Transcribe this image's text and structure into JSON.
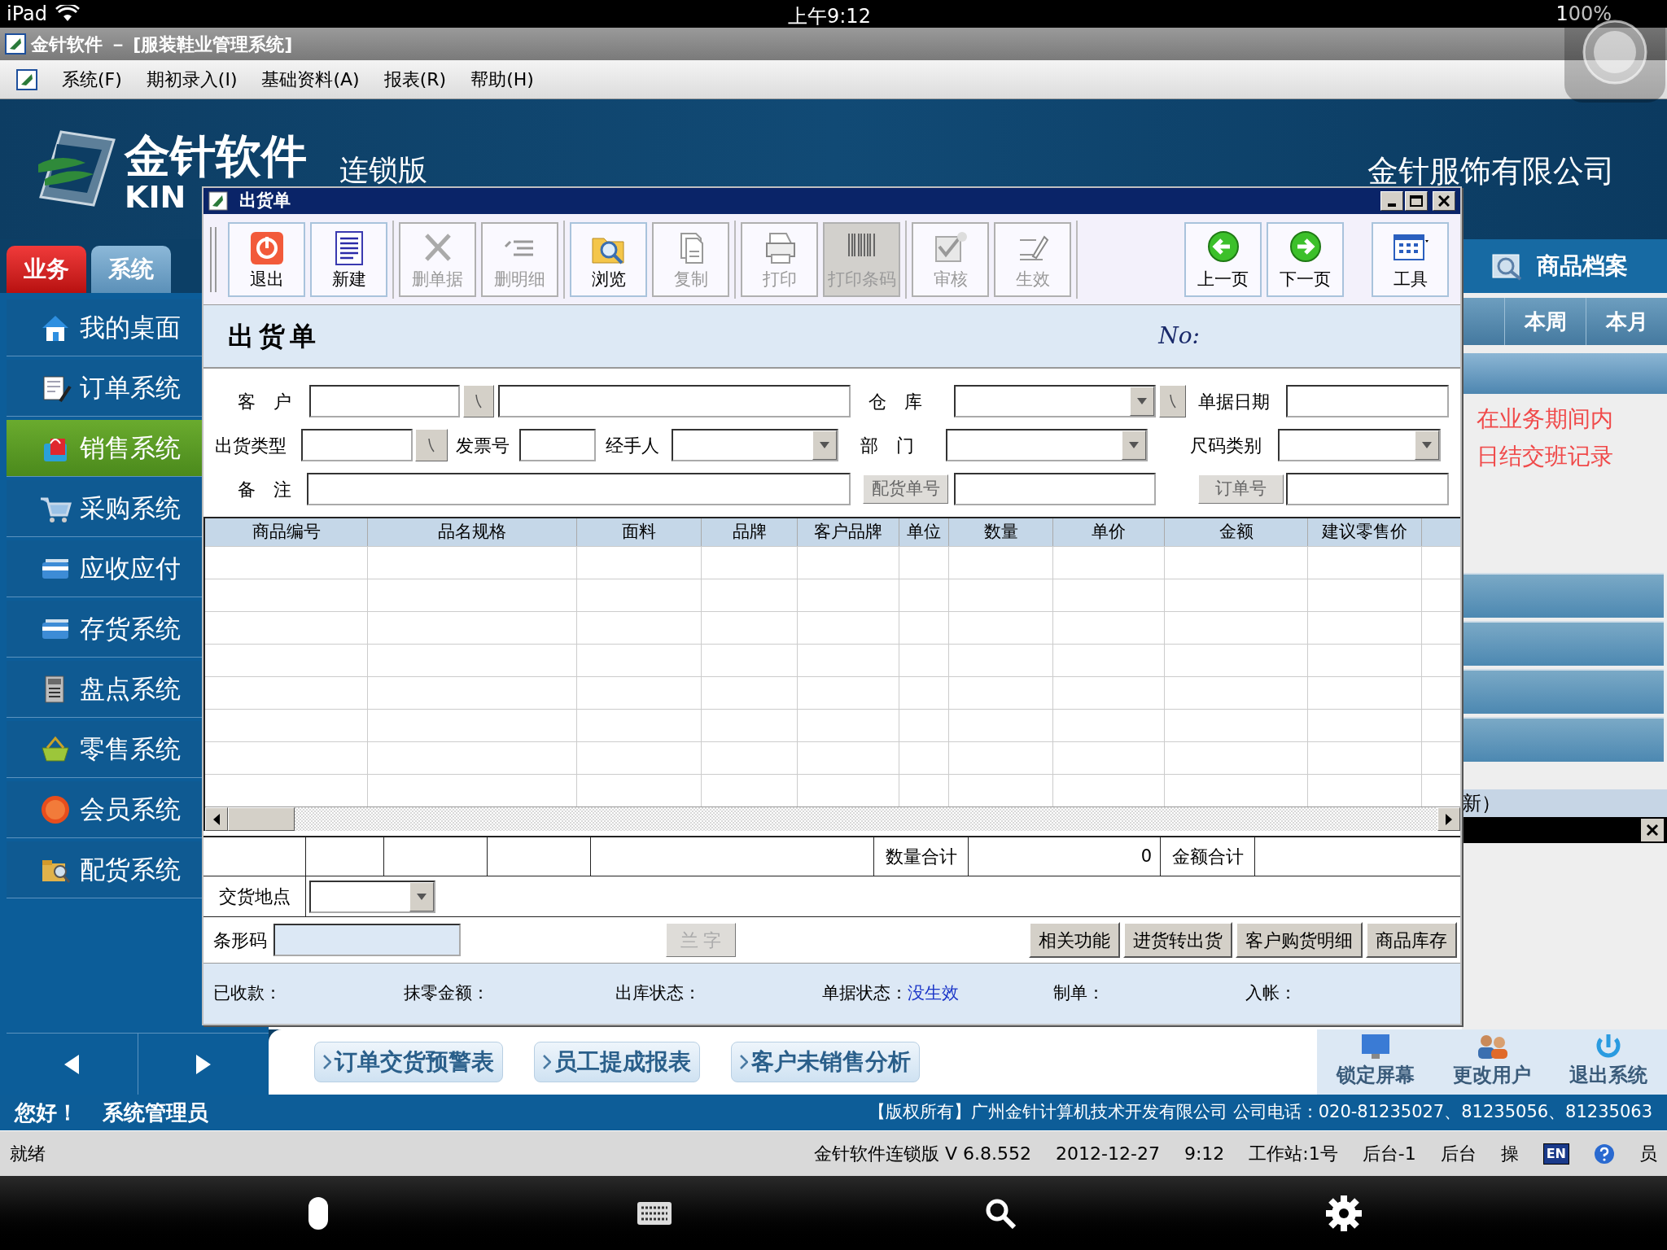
{
  "ios_status": {
    "device": "iPad",
    "time": "上午9:12",
    "battery": "100%"
  },
  "app_title": "金针软件 － [服装鞋业管理系统]",
  "menu": [
    "系统(F)",
    "期初录入(I)",
    "基础资料(A)",
    "报表(R)",
    "帮助(H)"
  ],
  "banner": {
    "brand": "金针软件",
    "brand_latin": "KIN",
    "edition": "连锁版",
    "company": "金针服饰有限公司"
  },
  "main_tabs": [
    {
      "label": "业务",
      "selected": true
    },
    {
      "label": "系统",
      "selected": false
    }
  ],
  "sidebar": [
    {
      "label": "我的桌面",
      "selected": false
    },
    {
      "label": "订单系统",
      "selected": false
    },
    {
      "label": "销售系统",
      "selected": true
    },
    {
      "label": "采购系统",
      "selected": false
    },
    {
      "label": "应收应付",
      "selected": false
    },
    {
      "label": "存货系统",
      "selected": false
    },
    {
      "label": "盘点系统",
      "selected": false
    },
    {
      "label": "零售系统",
      "selected": false
    },
    {
      "label": "会员系统",
      "selected": false
    },
    {
      "label": "配货系统",
      "selected": false
    }
  ],
  "right_panel": {
    "title": "商品档案",
    "tabs": [
      {
        "label": "本周",
        "selected": false
      },
      {
        "label": "本月",
        "selected": false
      }
    ],
    "notices": [
      "在业务期间内",
      "日结交班记录"
    ],
    "refresh": "新）"
  },
  "quick_reports": [
    "订单交货预警表",
    "员工提成报表",
    "客户未销售分析"
  ],
  "session_buttons": [
    "锁定屏幕",
    "更改用户",
    "退出系统"
  ],
  "greeting": "您好！",
  "user": "系统管理员",
  "copyright": "【版权所有】广州金针计算机技术开发有限公司  公司电话：020-81235027、81235056、81235063",
  "status_bar": {
    "left": "就绪",
    "items": [
      "金针软件连锁版 V 6.8.552",
      "2012-12-27",
      "9:12",
      "工作站:1号",
      "后台-1",
      "后台",
      "操"
    ],
    "language": "EN",
    "tail": "员"
  },
  "dialog": {
    "title": "出货单",
    "toolbar_left": [
      [
        {
          "label": "退出",
          "disabled": false,
          "pressed": false
        },
        {
          "label": "新建",
          "disabled": false,
          "pressed": false
        }
      ],
      [
        {
          "label": "删单据",
          "disabled": true,
          "pressed": false
        },
        {
          "label": "删明细",
          "disabled": true,
          "pressed": false
        }
      ],
      [
        {
          "label": "浏览",
          "disabled": false,
          "pressed": false
        },
        {
          "label": "复制",
          "disabled": true,
          "pressed": false
        }
      ],
      [
        {
          "label": "打印",
          "disabled": true,
          "pressed": false
        },
        {
          "label": "打印条码",
          "disabled": true,
          "pressed": true
        }
      ],
      [
        {
          "label": "审核",
          "disabled": true,
          "pressed": false
        },
        {
          "label": "生效",
          "disabled": true,
          "pressed": false
        }
      ]
    ],
    "toolbar_right": [
      [
        {
          "label": "上一页",
          "disabled": false,
          "pressed": false
        },
        {
          "label": "下一页",
          "disabled": false,
          "pressed": false
        }
      ],
      [
        {
          "label": "工具",
          "disabled": false,
          "pressed": false
        }
      ]
    ],
    "heading": "出货单",
    "number_label": "No:",
    "form": {
      "customer": "客　户",
      "warehouse": "仓　库",
      "doc_date": "单据日期",
      "ship_type": "出货类型",
      "invoice_no": "发票号",
      "handler": "经手人",
      "department": "部　门",
      "size_type": "尺码类别",
      "remark": "备　注",
      "allot_no": "配货单号",
      "order_no": "订单号"
    },
    "columns": [
      "商品编号",
      "品名规格",
      "面料",
      "品牌",
      "客户品牌",
      "单位",
      "数量",
      "单价",
      "金额",
      "建议零售价"
    ],
    "totals": {
      "qty_label": "数量合计",
      "qty": "0",
      "amount_label": "金额合计"
    },
    "delivery_label": "交货地点",
    "barcode_label": "条形码",
    "input_mode": {
      "label": "兰 字",
      "disabled": true
    },
    "actions": [
      "相关功能",
      "进货转出货",
      "客户购货明细",
      "商品库存"
    ],
    "footer": [
      {
        "label": "已收款："
      },
      {
        "label": "抹零金额："
      },
      {
        "label": "出库状态："
      },
      {
        "label": "单据状态：",
        "value": "没生效"
      },
      {
        "label": "制单："
      },
      {
        "label": "入帐："
      }
    ]
  }
}
